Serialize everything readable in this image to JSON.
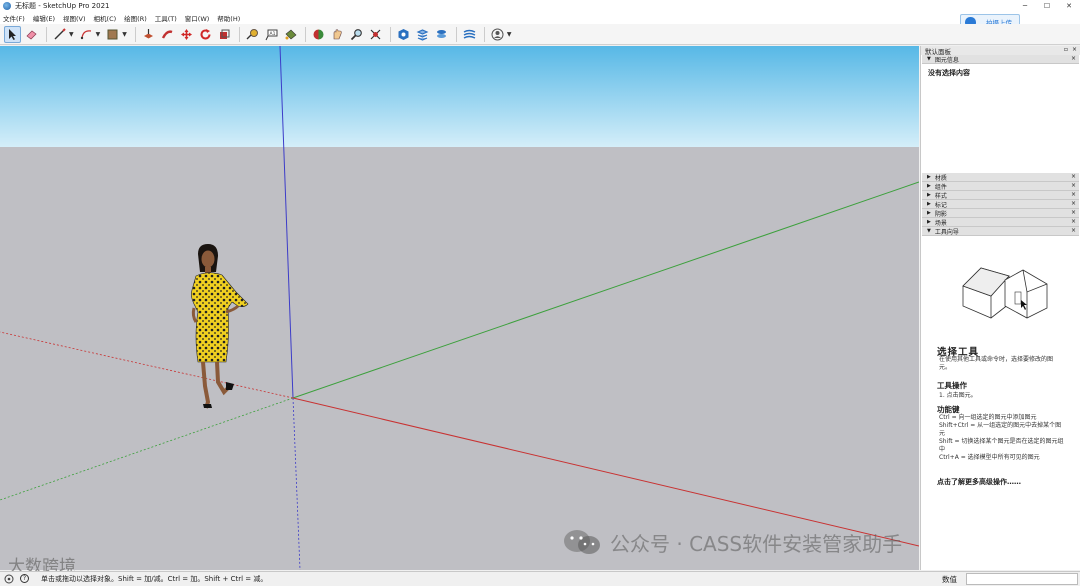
{
  "window": {
    "title": "无标题 - SketchUp Pro 2021",
    "controls": [
      "─",
      "☐",
      "✕"
    ]
  },
  "menu": [
    "文件(F)",
    "编辑(E)",
    "视图(V)",
    "相机(C)",
    "绘图(R)",
    "工具(T)",
    "窗口(W)",
    "帮助(H)"
  ],
  "cloud_button": {
    "label": "拍摄上传",
    "icon": "cloud-icon"
  },
  "toolbar": {
    "tools": [
      "select-icon",
      "eraser-icon",
      "line-icon",
      "arc-icon",
      "rectangle-icon",
      "push-pull-icon",
      "follow-me-icon",
      "move-icon",
      "rotate-icon",
      "scale-icon",
      "tape-measure-icon",
      "text-icon",
      "paint-bucket-icon",
      "orbit-icon",
      "pan-icon",
      "zoom-icon",
      "zoom-extents-icon",
      "warehouse-icon",
      "extension-icon",
      "layers-icon",
      "sandbox-icon",
      "profile-icon"
    ],
    "active_tool": "select-icon"
  },
  "panel": {
    "title": "默认面板",
    "pin": "▫",
    "close": "×",
    "entity_info": {
      "label": "图元信息",
      "content": "没有选择内容"
    },
    "trays": [
      "材质",
      "组件",
      "样式",
      "标记",
      "阴影",
      "场景"
    ],
    "instructor": {
      "label": "工具向导",
      "title": "选择工具",
      "description": "在使用其他工具或命令时，选择要修改的图元。",
      "ops_heading": "工具操作",
      "ops": "1. 点击图元。",
      "keys_heading": "功能键",
      "keys": [
        "Ctrl = 向一组选定的图元中添加图元",
        "Shift+Ctrl = 从一组选定的图元中去掉某个图元",
        "Shift = 切换选择某个图元是否在选定的图元组中",
        "Ctrl+A = 选择模型中所有可见的图元"
      ],
      "more": "点击了解更多高级操作……"
    }
  },
  "status": {
    "hint": "单击或拖动以选择对象。Shift = 加/减。Ctrl = 加。Shift + Ctrl = 减。",
    "measurements_label": "数值",
    "measurements_value": ""
  },
  "watermark": {
    "text": "公众号 · CASS软件安装管家助手",
    "left_text": "大数跨境"
  },
  "colors": {
    "sky_top": "#57b8e6",
    "sky_bottom": "#d4eef9",
    "ground": "#bfbfc4",
    "axis_red": "#c83232",
    "axis_green": "#3ca03c",
    "axis_blue": "#3c3cc8",
    "accent": "#2a7ad6"
  }
}
